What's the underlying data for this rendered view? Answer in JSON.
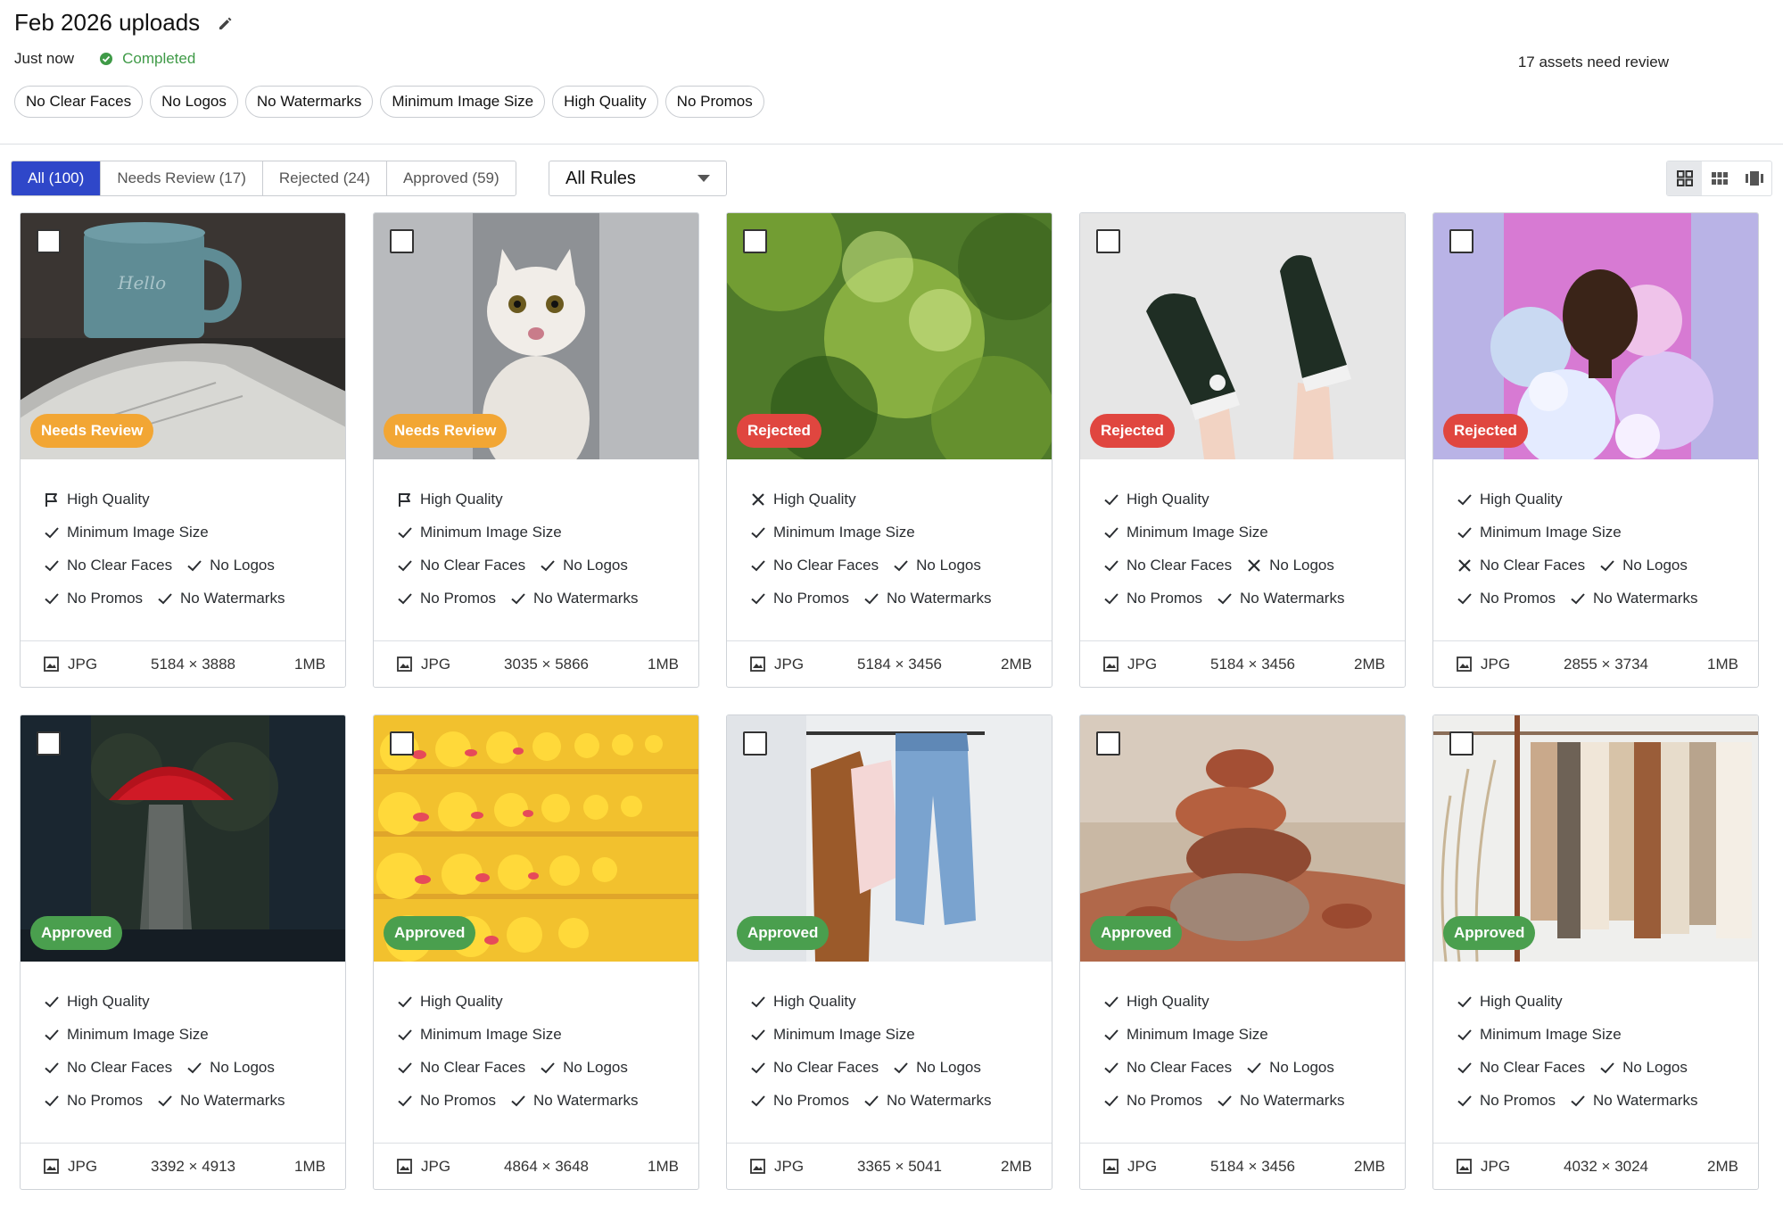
{
  "header": {
    "title": "Feb 2026 uploads",
    "status_time": "Just now",
    "status_label": "Completed",
    "review_note": "17 assets need review",
    "rules": [
      "No Clear Faces",
      "No Logos",
      "No Watermarks",
      "Minimum Image Size",
      "High Quality",
      "No Promos"
    ]
  },
  "toolbar": {
    "tabs": [
      "All (100)",
      "Needs Review (17)",
      "Rejected (24)",
      "Approved (59)"
    ],
    "rule_filter": "All Rules"
  },
  "colors": {
    "accent": "#2f47c9",
    "needs_review": "#f2a634",
    "rejected": "#e0463f",
    "approved": "#4a9f4e",
    "completed": "#3f9a47"
  },
  "cards": [
    {
      "scene": "coffee-mug-and-book",
      "status": "Needs Review",
      "status_key": "needs",
      "rules": [
        [
          "flag"
        ],
        [
          "check"
        ],
        [
          "check",
          "check"
        ],
        [
          "check",
          "check"
        ]
      ],
      "format": "JPG",
      "dims": "5184 × 3888",
      "size": "1MB"
    },
    {
      "scene": "white-cat",
      "status": "Needs Review",
      "status_key": "needs",
      "rules": [
        [
          "flag"
        ],
        [
          "check"
        ],
        [
          "check",
          "check"
        ],
        [
          "check",
          "check"
        ]
      ],
      "format": "JPG",
      "dims": "3035 × 5866",
      "size": "1MB"
    },
    {
      "scene": "green-bokeh",
      "status": "Rejected",
      "status_key": "rejected",
      "rules": [
        [
          "cross"
        ],
        [
          "check"
        ],
        [
          "check",
          "check"
        ],
        [
          "check",
          "check"
        ]
      ],
      "format": "JPG",
      "dims": "5184 × 3456",
      "size": "2MB"
    },
    {
      "scene": "sneakers",
      "status": "Rejected",
      "status_key": "rejected",
      "rules": [
        [
          "check"
        ],
        [
          "check"
        ],
        [
          "check",
          "cross"
        ],
        [
          "check",
          "check"
        ]
      ],
      "format": "JPG",
      "dims": "5184 × 3456",
      "size": "2MB"
    },
    {
      "scene": "man-in-flowers",
      "status": "Rejected",
      "status_key": "rejected",
      "rules": [
        [
          "check"
        ],
        [
          "check"
        ],
        [
          "cross",
          "check"
        ],
        [
          "check",
          "check"
        ]
      ],
      "format": "JPG",
      "dims": "2855 × 3734",
      "size": "1MB"
    },
    {
      "scene": "red-umbrella",
      "status": "Approved",
      "status_key": "approved",
      "rules": [
        [
          "check"
        ],
        [
          "check"
        ],
        [
          "check",
          "check"
        ],
        [
          "check",
          "check"
        ]
      ],
      "format": "JPG",
      "dims": "3392 × 4913",
      "size": "1MB"
    },
    {
      "scene": "rubber-ducks",
      "status": "Approved",
      "status_key": "approved",
      "rules": [
        [
          "check"
        ],
        [
          "check"
        ],
        [
          "check",
          "check"
        ],
        [
          "check",
          "check"
        ]
      ],
      "format": "JPG",
      "dims": "4864 × 3648",
      "size": "1MB"
    },
    {
      "scene": "clothes-rack",
      "status": "Approved",
      "status_key": "approved",
      "rules": [
        [
          "check"
        ],
        [
          "check"
        ],
        [
          "check",
          "check"
        ],
        [
          "check",
          "check"
        ]
      ],
      "format": "JPG",
      "dims": "3365 × 5041",
      "size": "2MB"
    },
    {
      "scene": "stacked-rocks",
      "status": "Approved",
      "status_key": "approved",
      "rules": [
        [
          "check"
        ],
        [
          "check"
        ],
        [
          "check",
          "check"
        ],
        [
          "check",
          "check"
        ]
      ],
      "format": "JPG",
      "dims": "5184 × 3456",
      "size": "2MB"
    },
    {
      "scene": "sweaters-on-rack",
      "status": "Approved",
      "status_key": "approved",
      "rules": [
        [
          "check"
        ],
        [
          "check"
        ],
        [
          "check",
          "check"
        ],
        [
          "check",
          "check"
        ]
      ],
      "format": "JPG",
      "dims": "4032 × 3024",
      "size": "2MB"
    }
  ],
  "rule_rows": [
    [
      "High Quality"
    ],
    [
      "Minimum Image Size"
    ],
    [
      "No Clear Faces",
      "No Logos"
    ],
    [
      "No Promos",
      "No Watermarks"
    ]
  ]
}
